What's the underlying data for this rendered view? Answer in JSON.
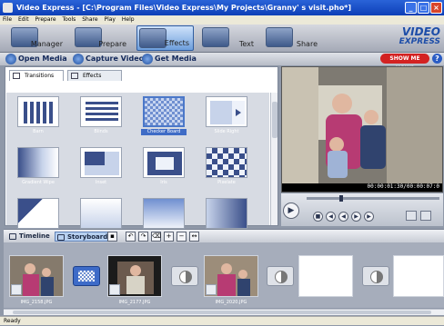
{
  "window": {
    "title": "Video Express - [C:\\Program Files\\Video Express\\My Projects\\Granny' s visit.pho*]"
  },
  "menu": [
    "File",
    "Edit",
    "Prepare",
    "Tools",
    "Share",
    "Play",
    "Help"
  ],
  "modes": [
    {
      "label": "Manager"
    },
    {
      "label": "Prepare"
    },
    {
      "label": "Effects",
      "active": true
    },
    {
      "label": "Text"
    },
    {
      "label": "Share"
    }
  ],
  "logo": {
    "line1": "VIDEO",
    "line2": "EXPRESS"
  },
  "actions": {
    "open": "Open Media",
    "capture": "Capture Video",
    "get": "Get Media",
    "showme": "SHOW ME HOW?",
    "help": "?"
  },
  "tabs": [
    {
      "label": "Transitions",
      "selected": true
    },
    {
      "label": "Effects",
      "selected": false
    }
  ],
  "transitions": [
    "Barn",
    "Blinds",
    "Checker Board",
    "Slide Right",
    "Gradient Wipe",
    "Inset",
    "Iris",
    "Pixelate",
    "",
    "",
    "",
    ""
  ],
  "selected_transition": "Checker Board",
  "preview": {
    "timecode": "00:00:01:30/00:00:07:0"
  },
  "timeline": {
    "timeline_label": "Timeline",
    "storyboard_label": "Storyboard"
  },
  "clips": [
    {
      "label": "IMG_2158.JPG"
    },
    {
      "label": "IMG_2177.JPG"
    },
    {
      "label": "IMG_2020.JPG"
    }
  ],
  "status": "Ready",
  "colors": {
    "accent": "#3f6cc6",
    "titlebar": "#1d4fc9"
  }
}
